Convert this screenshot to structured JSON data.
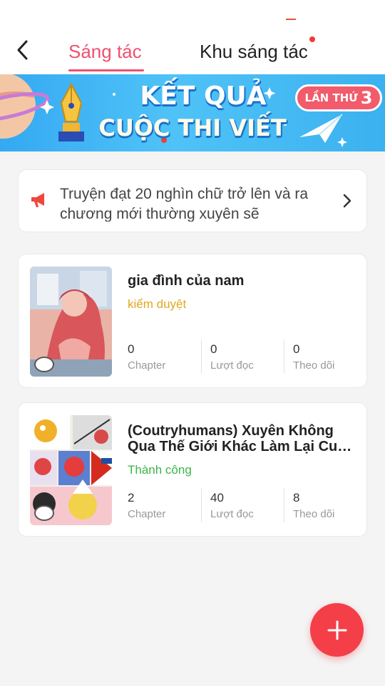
{
  "header": {
    "tab_active": "Sáng tác",
    "tab_inactive": "Khu sáng tác"
  },
  "banner": {
    "line1": "KẾT QUẢ",
    "line2": "CUỘC THI VIẾT",
    "badge_text": "LẦN THỨ",
    "badge_number": "3"
  },
  "notice": {
    "text": "Truyện đạt 20 nghìn chữ trở lên và ra chương mới thường xuyên sẽ"
  },
  "stories": [
    {
      "title": "gia đình của nam",
      "status": "kiểm duyệt",
      "status_color": "#e0a81c",
      "stats": [
        {
          "value": "0",
          "label": "Chapter"
        },
        {
          "value": "0",
          "label": "Lượt đọc"
        },
        {
          "value": "0",
          "label": "Theo dõi"
        }
      ]
    },
    {
      "title_line1": "(Coutryhumans) Xuyên Không",
      "title_line2": "Qua Thế Giới Khác Làm Lại Cuộc...",
      "status": "Thành công",
      "status_color": "#3bb54a",
      "stats": [
        {
          "value": "2",
          "label": "Chapter"
        },
        {
          "value": "40",
          "label": "Lượt đọc"
        },
        {
          "value": "8",
          "label": "Theo dõi"
        }
      ]
    }
  ],
  "colors": {
    "accent": "#f0506e",
    "fab": "#f43f49"
  }
}
